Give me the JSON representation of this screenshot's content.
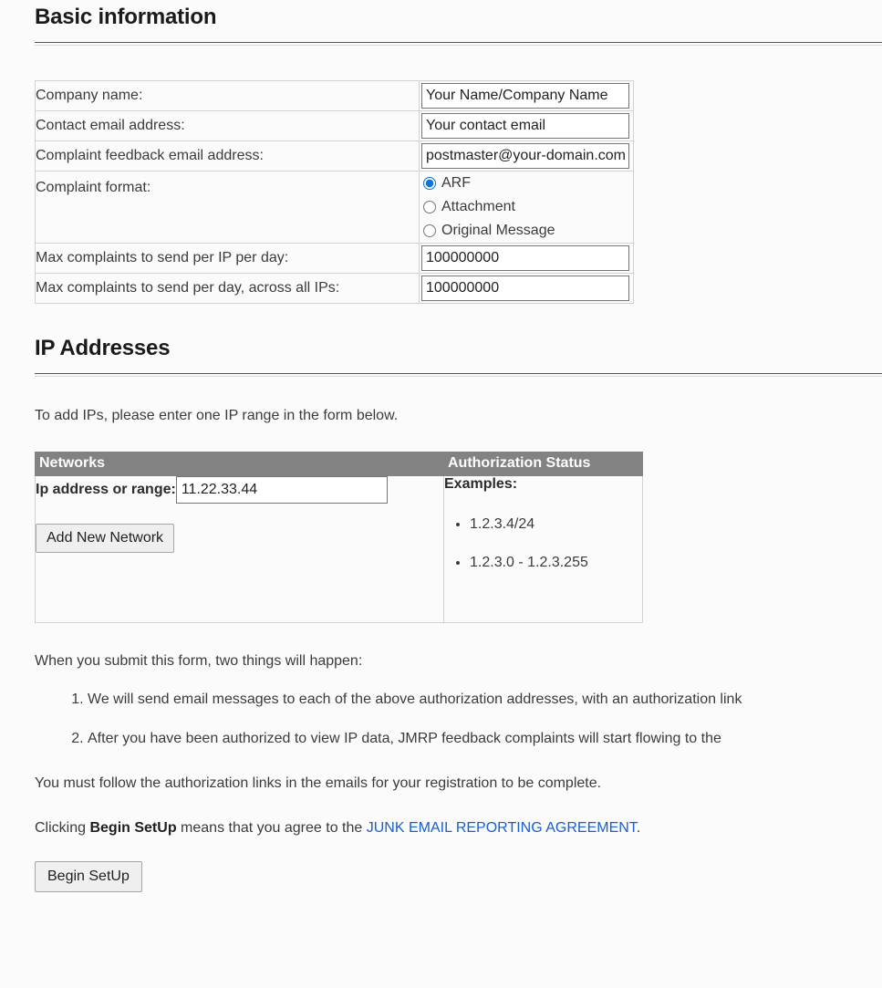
{
  "basic_information": {
    "heading": "Basic information",
    "rows": [
      {
        "label": "Company name:",
        "value": "Your Name/Company Name",
        "field_name": "company-name-input"
      },
      {
        "label": "Contact email address:",
        "value": "Your contact email",
        "field_name": "contact-email-input"
      },
      {
        "label": "Complaint feedback email address:",
        "value": "postmaster@your-domain.com",
        "field_name": "complaint-feedback-email-input"
      }
    ],
    "complaint_format": {
      "label": "Complaint format:",
      "options": [
        {
          "label": "ARF",
          "selected": true
        },
        {
          "label": "Attachment",
          "selected": false
        },
        {
          "label": "Original Message",
          "selected": false
        }
      ]
    },
    "limits": [
      {
        "label": "Max complaints to send per IP per day:",
        "value": "100000000",
        "field_name": "max-complaints-per-ip-input"
      },
      {
        "label": "Max complaints to send per day, across all IPs:",
        "value": "100000000",
        "field_name": "max-complaints-total-input"
      }
    ]
  },
  "ip_addresses": {
    "heading": "IP Addresses",
    "lead": "To add IPs, please enter one IP range in the form below.",
    "table": {
      "headers": [
        "Networks",
        "Authorization Status"
      ],
      "ip_label": "Ip address or range:",
      "ip_value": "11.22.33.44",
      "add_button": "Add New Network",
      "examples_title": "Examples:",
      "examples": [
        "1.2.3.4/24",
        "1.2.3.0 - 1.2.3.255"
      ]
    }
  },
  "footer": {
    "intro": "When you submit this form, two things will happen:",
    "steps": [
      "We will send email messages to each of the above authorization addresses, with an authorization link",
      "After you have been authorized to view IP data, JMRP feedback complaints will start flowing to the"
    ],
    "note": "You must follow the authorization links in the emails for your registration to be complete.",
    "agreement_prefix": "Clicking ",
    "agreement_bold": "Begin SetUp",
    "agreement_middle": " means that you agree to the ",
    "agreement_link": "JUNK EMAIL REPORTING AGREEMENT",
    "agreement_suffix": ".",
    "begin_button": "Begin SetUp"
  },
  "colors": {
    "table_header_bg": "#828282",
    "link": "#1a5fd0",
    "radio_accent": "#0a73dc",
    "page_bg": "#fbfbfb"
  }
}
